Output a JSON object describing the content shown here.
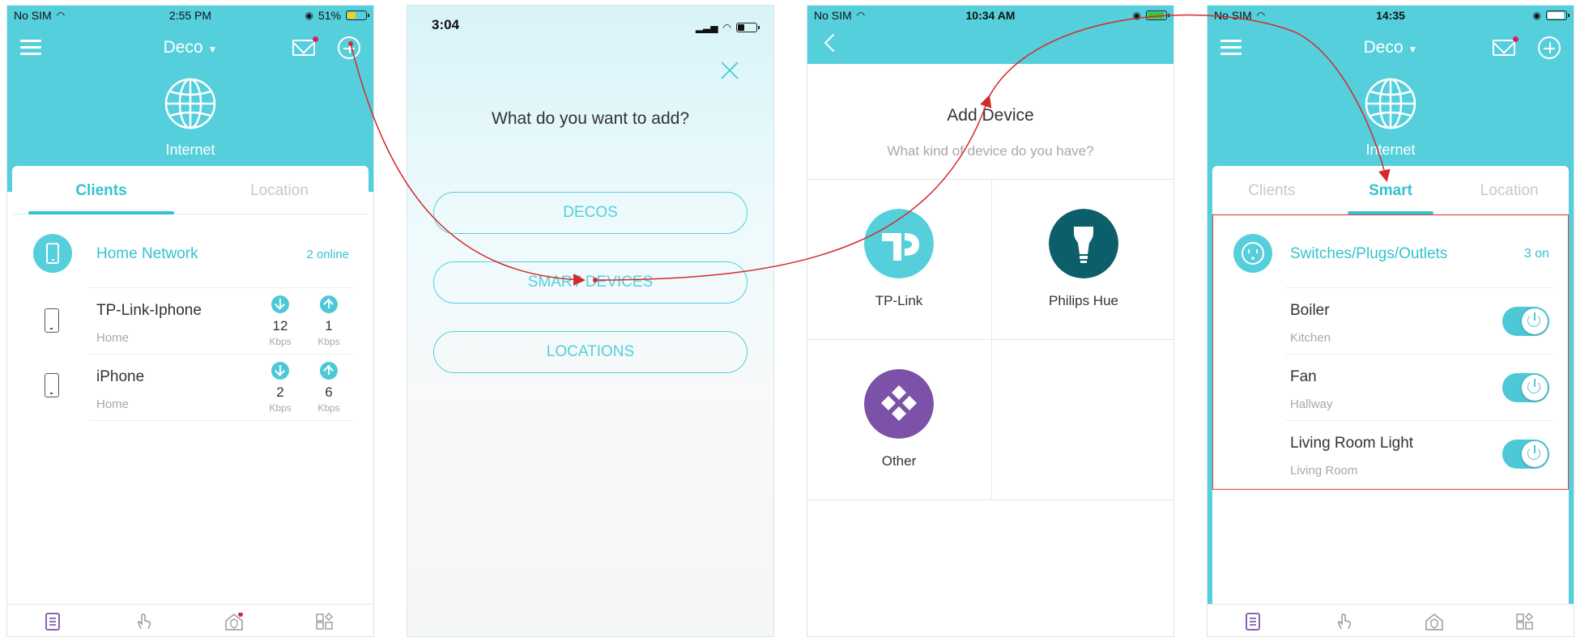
{
  "screen1": {
    "status": {
      "carrier": "No SIM",
      "time": "2:55 PM",
      "battery": "51%"
    },
    "title": "Deco",
    "internet_label": "Internet",
    "tabs": [
      "Clients",
      "Location"
    ],
    "network": {
      "name": "Home Network",
      "status": "2 online"
    },
    "clients": [
      {
        "name": "TP-Link-Iphone",
        "location": "Home",
        "down": "12",
        "up": "1",
        "unit": "Kbps"
      },
      {
        "name": "iPhone",
        "location": "Home",
        "down": "2",
        "up": "6",
        "unit": "Kbps"
      }
    ]
  },
  "screen2": {
    "time": "3:04",
    "title": "What do you want to add?",
    "options": [
      "DECOS",
      "SMART DEVICES",
      "LOCATIONS"
    ]
  },
  "screen3": {
    "status": {
      "carrier": "No SIM",
      "time": "10:34 AM"
    },
    "title": "Add Device",
    "subtitle": "What kind of device do you have?",
    "devices": [
      "TP-Link",
      "Philips Hue",
      "Other"
    ]
  },
  "screen4": {
    "status": {
      "carrier": "No SIM",
      "time": "14:35"
    },
    "title": "Deco",
    "internet_label": "Internet",
    "tabs": [
      "Clients",
      "Smart",
      "Location"
    ],
    "group": {
      "name": "Switches/Plugs/Outlets",
      "status": "3 on"
    },
    "items": [
      {
        "name": "Boiler",
        "location": "Kitchen",
        "on": true
      },
      {
        "name": "Fan",
        "location": "Hallway",
        "on": true
      },
      {
        "name": "Living Room Light",
        "location": "Living Room",
        "on": true
      }
    ]
  },
  "colors": {
    "teal": "#55cfdb",
    "accent": "#33c3d0",
    "arrow": "#d42a2a",
    "tplink": "#55cfdb",
    "hue": "#0b5e6a",
    "other": "#7b52a8"
  },
  "icons": [
    "menu-icon",
    "mail-icon",
    "plus-icon",
    "globe-icon",
    "phone-icon",
    "download-icon",
    "upload-icon",
    "close-icon",
    "back-icon",
    "tplink-logo-icon",
    "hue-bulb-icon",
    "diamond-grid-icon",
    "outlet-icon",
    "power-icon"
  ]
}
